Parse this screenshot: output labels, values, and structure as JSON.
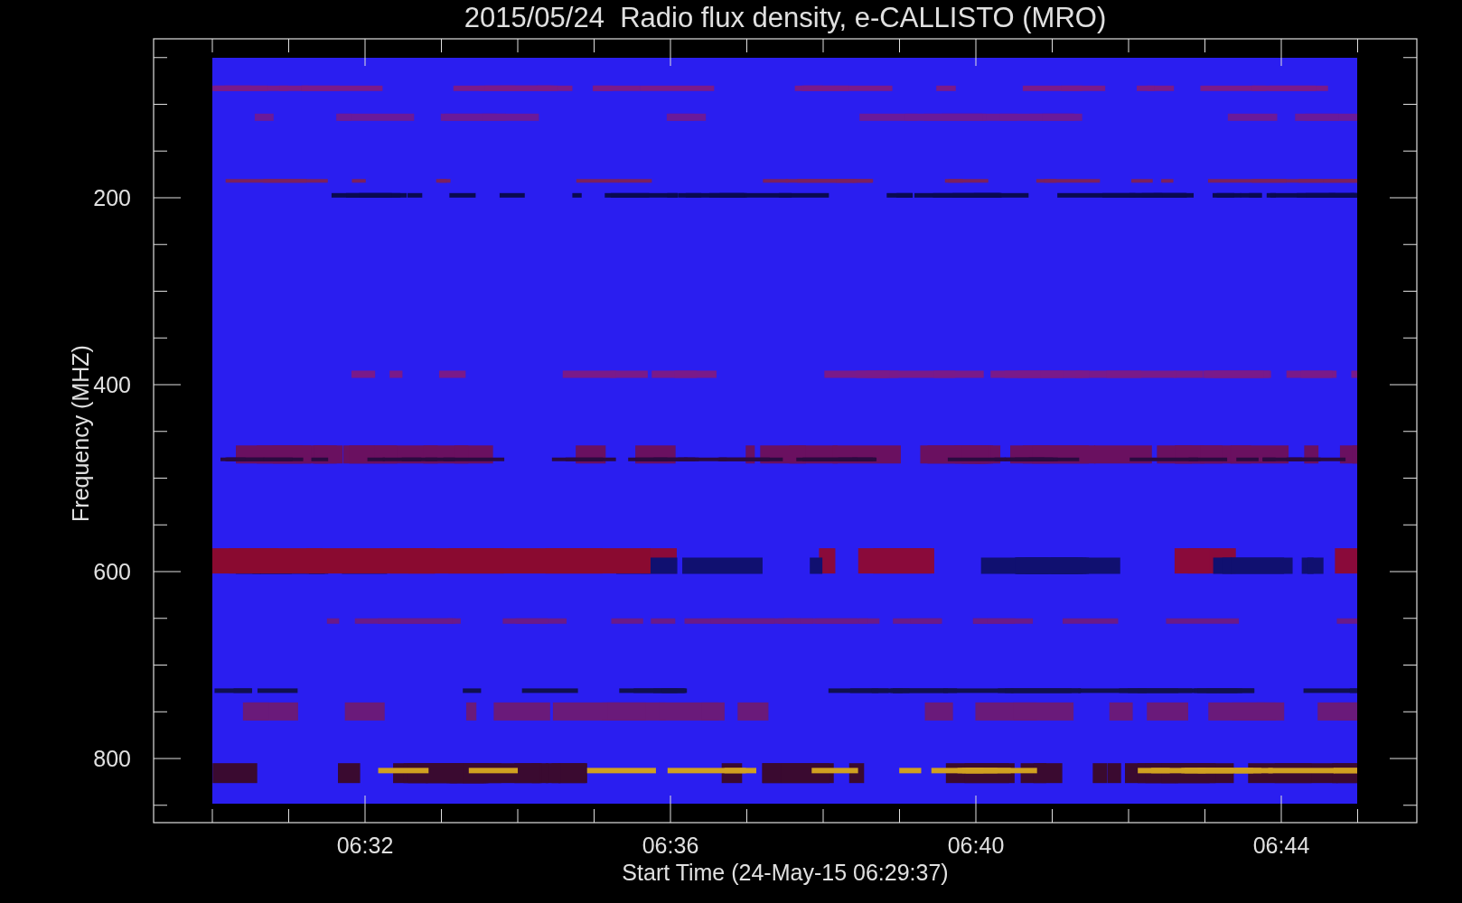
{
  "title": "2015/05/24  Radio flux density, e-CALLISTO (MRO)",
  "y_axis": {
    "label": "Frequency (MHZ)",
    "ticks": [
      "200",
      "400",
      "600",
      "800"
    ]
  },
  "x_axis": {
    "label": "Start Time (24-May-15 06:29:37)",
    "ticks": [
      "06:32",
      "06:36",
      "06:40",
      "06:44"
    ]
  }
}
